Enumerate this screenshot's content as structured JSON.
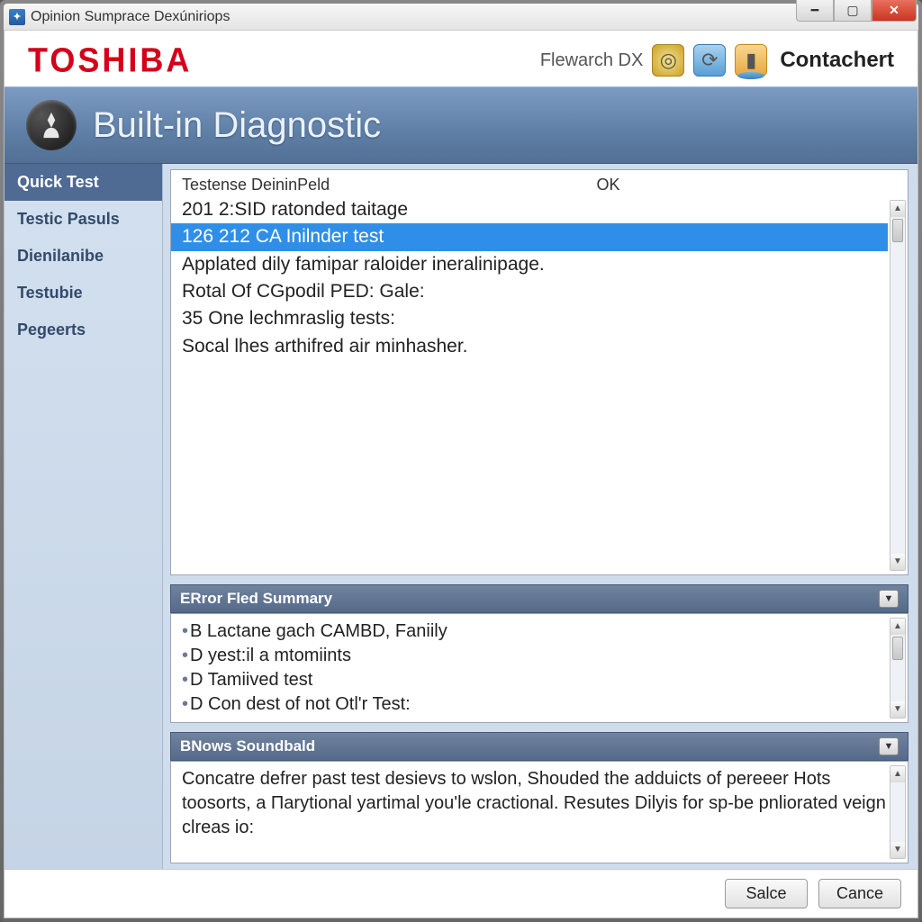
{
  "window": {
    "title": "Opinion Sumprace Dexúniriops"
  },
  "brand": {
    "logo_text": "TOSHIBA",
    "search_label": "Flewarch DX",
    "contact_label": "Contachert"
  },
  "hero": {
    "title": "Built-in Diagnostic"
  },
  "sidebar": {
    "items": [
      {
        "label": "Quick Test",
        "active": true
      },
      {
        "label": "Testic Pasuls",
        "active": false
      },
      {
        "label": "Dienilanibe",
        "active": false
      },
      {
        "label": "Testubie",
        "active": false
      },
      {
        "label": "Pegeerts",
        "active": false
      }
    ]
  },
  "log": {
    "header_col1": "Testense DeininPeld",
    "header_col2": "OK",
    "lines": [
      "201 2:SID ratonded taitage",
      "126 212 CA Inilnder test",
      "Applated dily famipar raloider ineralinipage.",
      "Rotal Of CGpodil PED: Gale:",
      "35 One lechmraslig tests:",
      "Socal lhes arthifred air minhasher."
    ],
    "selected_index": 1
  },
  "summary": {
    "title": "ERror Fled Summary",
    "items": [
      "B Lactane gach CAMBD, Faniily",
      "D yest:il a mtomiints",
      "D Tamiived test",
      "D Con dest of not Otl'r Test:"
    ]
  },
  "sound": {
    "title": "BNows Soundbald",
    "body": "Concatre defrer past test desievs to wslon, Shouded the adduicts of pereeer Hots toosorts, a Пarytional yartimal you'le cractional. Resutes Dilyis for sp-be pnliorated veign clreas io:"
  },
  "footer": {
    "save_label": "Salce",
    "cancel_label": "Cance"
  }
}
